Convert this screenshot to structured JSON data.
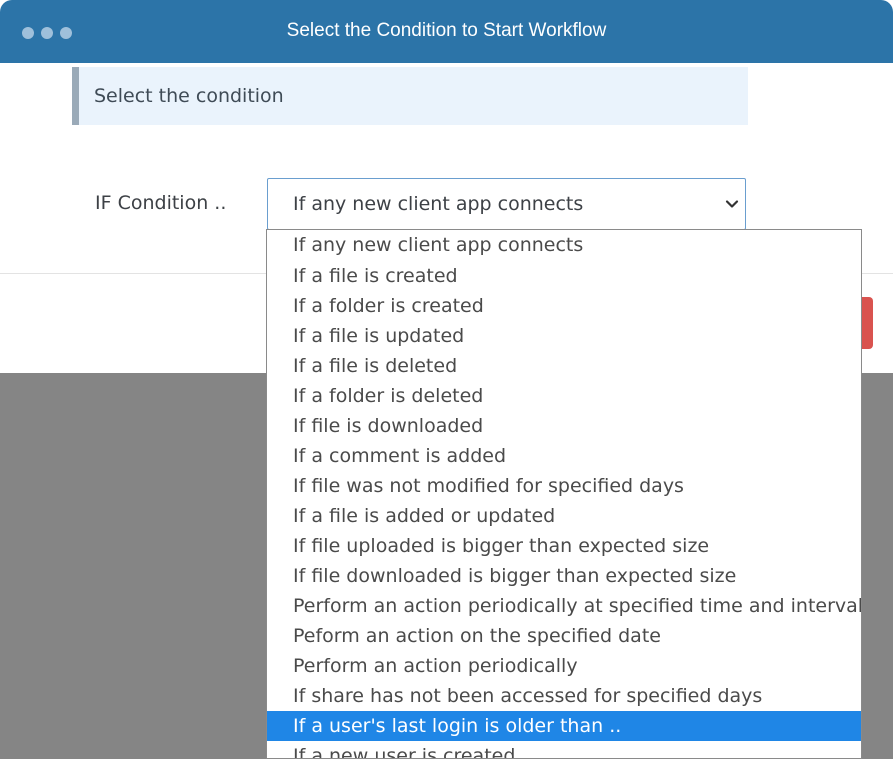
{
  "window": {
    "title": "Select the Condition to Start Workflow"
  },
  "info_banner": {
    "text": "Select the condition"
  },
  "condition": {
    "label": "IF Condition ..",
    "selected_value": "If any new client app connects",
    "chevron_icon": "chevron-down-icon"
  },
  "dropdown": {
    "options": [
      "If any new client app connects",
      "If a file is created",
      "If a folder is created",
      "If a file is updated",
      "If a file is deleted",
      "If a folder is deleted",
      "If file is downloaded",
      "If a comment is added",
      "If file was not modified for specified days",
      "If a file is added or updated",
      "If file uploaded is bigger than expected size",
      "If file downloaded is bigger than expected size",
      "Perform an action periodically at specified time and interval",
      "Peform an action on the specified date",
      "Perform an action periodically",
      "If share has not been accessed for specified days",
      "If a user's last login is older than ..",
      "If a new user is created"
    ],
    "highlighted": "If a user's last login is older than .."
  },
  "colors": {
    "titlebar": "#2c74a8",
    "highlight": "#1f86e6",
    "danger_button": "#d9534f",
    "overlay": "#858585"
  }
}
